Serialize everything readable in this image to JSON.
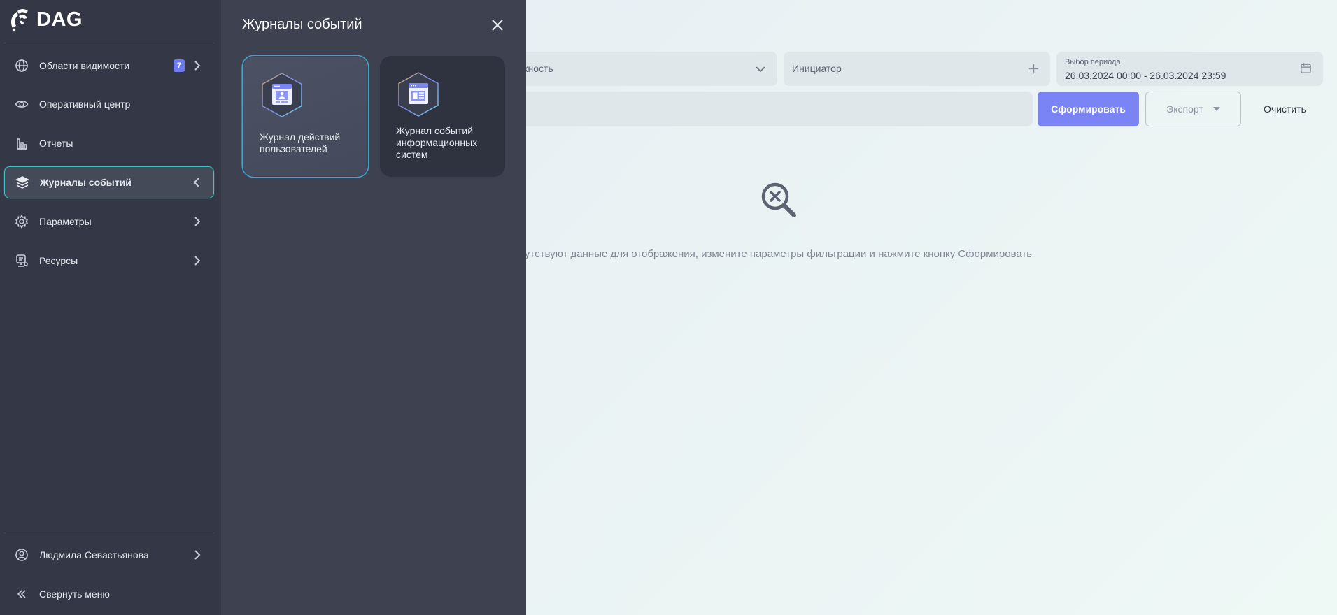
{
  "app": {
    "brand": "DAG"
  },
  "sidebar": {
    "items": [
      {
        "label": "Области видимости",
        "badge": "7",
        "icon": "globe-icon"
      },
      {
        "label": "Оперативный центр",
        "icon": "eye-icon"
      },
      {
        "label": "Отчеты",
        "icon": "bar-chart-icon"
      },
      {
        "label": "Журналы событий",
        "icon": "layers-icon",
        "active": true
      },
      {
        "label": "Параметры",
        "icon": "gear-icon"
      },
      {
        "label": "Ресурсы",
        "icon": "resources-icon"
      }
    ],
    "user": {
      "name": "Людмила Севастьянова",
      "icon": "user-circle-icon"
    },
    "collapse": {
      "label": "Свернуть меню",
      "icon": "double-chevron-left-icon"
    }
  },
  "flyout": {
    "title": "Журналы событий",
    "cards": [
      {
        "label": "Журнал действий пользователей",
        "icon": "user-window-icon",
        "selected": true
      },
      {
        "label": "Журнал событий информационных систем",
        "icon": "system-window-icon"
      }
    ]
  },
  "filters": {
    "severity_placeholder": "Важность",
    "initiator_placeholder": "Инициатор",
    "period_label": "Выбор периода",
    "period_value": "26.03.2024 00:00 - 26.03.2024 23:59"
  },
  "actions": {
    "form_label": "Сформировать",
    "export_label": "Экспорт",
    "clear_label": "Очистить"
  },
  "empty_state": {
    "message": "Отсутствуют данные для отображения, измените параметры фильтрации и нажмите кнопку Сформировать",
    "icon": "search-x-icon"
  },
  "colors": {
    "sidebar_bg": "#343846",
    "flyout_bg": "#3d4150",
    "accent": "#7a84f5",
    "active_border": "#3fc2c8",
    "badge": "#6c7bf0"
  }
}
